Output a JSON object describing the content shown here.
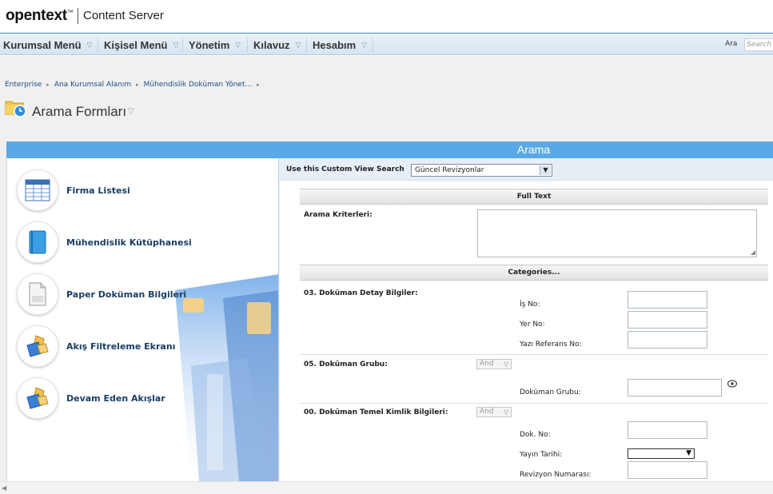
{
  "header": {
    "brand": "opentext",
    "brand_tm": "™",
    "product": "Content Server"
  },
  "menubar": {
    "items": [
      {
        "label": "Kurumsal Menü"
      },
      {
        "label": "Kişisel Menü"
      },
      {
        "label": "Yönetim"
      },
      {
        "label": "Kılavuz"
      },
      {
        "label": "Hesabım"
      }
    ],
    "search_label": "Ara",
    "search_placeholder": "Search"
  },
  "breadcrumb": [
    "Enterprise",
    "Ana Kurumsal Alanım",
    "Mühendislik Doküman Yönet..."
  ],
  "page": {
    "title": "Arama Formları"
  },
  "panel": {
    "title": "Arama"
  },
  "left_items": [
    {
      "label": "Firma Listesi",
      "icon": "table-icon"
    },
    {
      "label": "Mühendislik Kütüphanesi",
      "icon": "book-icon"
    },
    {
      "label": "Paper Doküman Bilgileri",
      "icon": "document-icon"
    },
    {
      "label": "Akış Filtreleme Ekranı",
      "icon": "workflow-icon"
    },
    {
      "label": "Devam Eden Akışlar",
      "icon": "workflow-icon"
    }
  ],
  "custom_view": {
    "label": "Use this Custom View Search",
    "selected": "Güncel Revizyonlar"
  },
  "form": {
    "full_text_header": "Full Text",
    "criteria_label": "Arama Kriterleri:",
    "categories_header": "Categories...",
    "group1": {
      "title": "03. Doküman Detay Bilgiler:",
      "fields": [
        "İş No:",
        "Yer No:",
        "Yazı Referans No:"
      ]
    },
    "group2": {
      "title": "05. Doküman Grubu:",
      "operator": "And",
      "fields": [
        "Doküman Grubu:"
      ]
    },
    "group3": {
      "title": "00. Doküman Temel Kimlik Bilgileri:",
      "operator": "And",
      "fields": [
        "Dok. No:",
        "Yayın Tarihi:",
        "Revizyon Numarası:"
      ]
    }
  }
}
